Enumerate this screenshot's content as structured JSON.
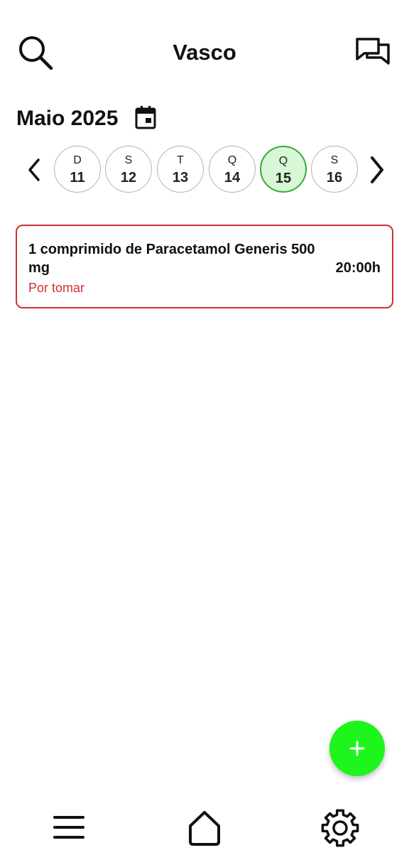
{
  "header": {
    "title": "Vasco",
    "left_icon": "search-icon",
    "right_icon": "chat-icon"
  },
  "calendar": {
    "month_label": "Maio 2025",
    "calendar_icon": "calendar-icon",
    "prev_icon": "chevron-left-icon",
    "next_icon": "chevron-right-icon",
    "days": [
      {
        "letter": "D",
        "number": "11",
        "selected": false
      },
      {
        "letter": "S",
        "number": "12",
        "selected": false
      },
      {
        "letter": "T",
        "number": "13",
        "selected": false
      },
      {
        "letter": "Q",
        "number": "14",
        "selected": false
      },
      {
        "letter": "Q",
        "number": "15",
        "selected": true
      },
      {
        "letter": "S",
        "number": "16",
        "selected": false
      }
    ]
  },
  "medications": [
    {
      "name": "1 comprimido de Paracetamol Generis 500 mg",
      "time": "20:00h",
      "status": "Por tomar",
      "status_color": "#d32f2f"
    }
  ],
  "fab": {
    "icon": "plus-icon",
    "color": "#1df51d"
  },
  "bottom_nav": {
    "items": [
      {
        "icon": "menu-icon"
      },
      {
        "icon": "home-icon"
      },
      {
        "icon": "gear-icon"
      }
    ]
  },
  "colors": {
    "selected_day_bg": "#d7f7d7",
    "selected_day_border": "#3ea83e",
    "card_border": "#d32f2f"
  }
}
